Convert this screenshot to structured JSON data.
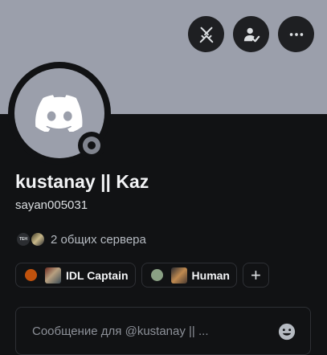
{
  "profile": {
    "display_name": "kustanay || Kaz",
    "username": "sayan005031",
    "status": "offline"
  },
  "actions": {
    "block_icon": "crossed-swords-icon",
    "add_friend_icon": "add-friend-icon",
    "more_icon": "ellipsis-icon"
  },
  "mutual": {
    "server1_abbr": "TEH",
    "text": "2 общих сервера"
  },
  "tags": [
    {
      "label": "IDL Captain",
      "color": "#c0520d"
    },
    {
      "label": "Human",
      "color": "#8aa084"
    }
  ],
  "add_symbol": "+",
  "message": {
    "placeholder": "Сообщение для @kustanay || ..."
  },
  "colors": {
    "banner": "#9b9fab",
    "background": "#111214",
    "status_offline": "#80848e"
  }
}
